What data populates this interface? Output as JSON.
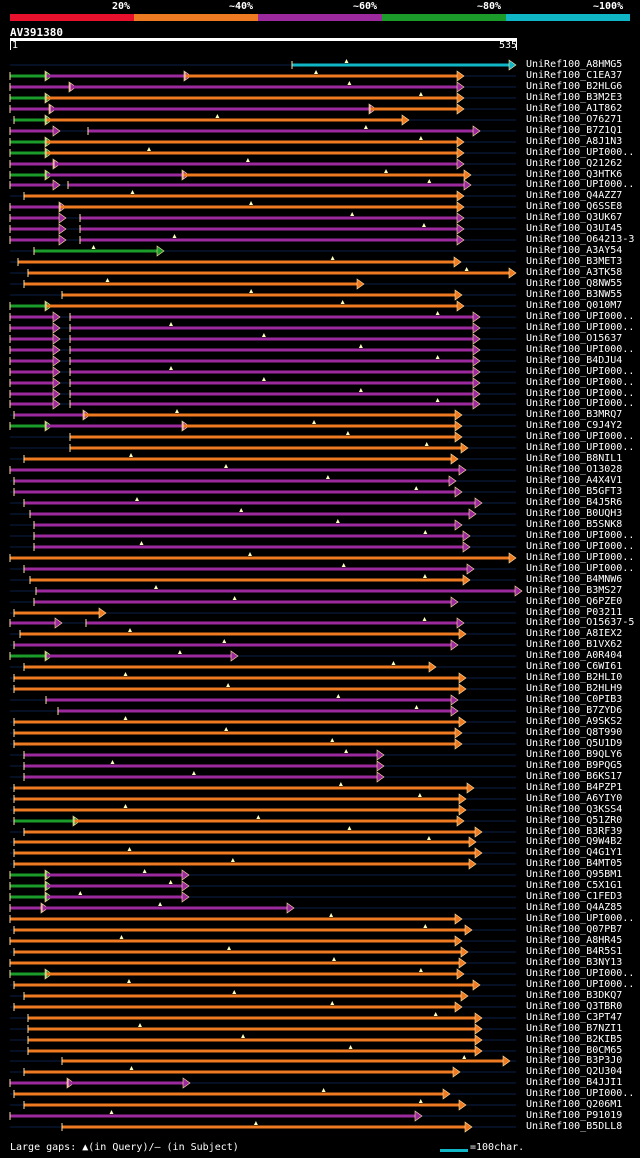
{
  "legend": {
    "labels": [
      "20%",
      "~40%",
      "~60%",
      "~80%",
      "~100%"
    ],
    "colors": [
      "#e8112d",
      "#ee7a21",
      "#9c2a9e",
      "#1a9b2a",
      "#10b5c6"
    ]
  },
  "query": {
    "id": "AV391380",
    "start": "1",
    "end": "535"
  },
  "hits": [
    {
      "name": "UniRef100_A8HMG5"
    },
    {
      "name": "UniRef100_C1EA37"
    },
    {
      "name": "UniRef100_B2HLG6"
    },
    {
      "name": "UniRef100_B3M2E3"
    },
    {
      "name": "UniRef100_A1T862"
    },
    {
      "name": "UniRef100_O76271"
    },
    {
      "name": "UniRef100_B7Z1Q1"
    },
    {
      "name": "UniRef100_A8J1N3"
    },
    {
      "name": "UniRef100_UPI000.."
    },
    {
      "name": "UniRef100_Q21262"
    },
    {
      "name": "UniRef100_Q3HTK6"
    },
    {
      "name": "UniRef100_UPI000.."
    },
    {
      "name": "UniRef100_Q4AZZ7"
    },
    {
      "name": "UniRef100_Q6SSE8"
    },
    {
      "name": "UniRef100_Q3UK67"
    },
    {
      "name": "UniRef100_Q3UI45"
    },
    {
      "name": "UniRef100_O64213-3"
    },
    {
      "name": "UniRef100_A3AY54"
    },
    {
      "name": "UniRef100_B3MET3"
    },
    {
      "name": "UniRef100_A3TK58"
    },
    {
      "name": "UniRef100_Q8NW55"
    },
    {
      "name": "UniRef100_B3NW55"
    },
    {
      "name": "UniRef100_Q010M7"
    },
    {
      "name": "UniRef100_UPI000.."
    },
    {
      "name": "UniRef100_UPI000.."
    },
    {
      "name": "UniRef100_O15637"
    },
    {
      "name": "UniRef100_UPI000.."
    },
    {
      "name": "UniRef100_B4DJU4"
    },
    {
      "name": "UniRef100_UPI000.."
    },
    {
      "name": "UniRef100_UPI000.."
    },
    {
      "name": "UniRef100_UPI000.."
    },
    {
      "name": "UniRef100_UPI000.."
    },
    {
      "name": "UniRef100_B3MRQ7"
    },
    {
      "name": "UniRef100_C9J4Y2"
    },
    {
      "name": "UniRef100_UPI000.."
    },
    {
      "name": "UniRef100_UPI000.."
    },
    {
      "name": "UniRef100_B8NIL1"
    },
    {
      "name": "UniRef100_O13028"
    },
    {
      "name": "UniRef100_A4X4V1"
    },
    {
      "name": "UniRef100_B5GFT3"
    },
    {
      "name": "UniRef100_B4J5R6"
    },
    {
      "name": "UniRef100_B0UQH3"
    },
    {
      "name": "UniRef100_B5SNK8"
    },
    {
      "name": "UniRef100_UPI000.."
    },
    {
      "name": "UniRef100_UPI000.."
    },
    {
      "name": "UniRef100_UPI000.."
    },
    {
      "name": "UniRef100_UPI000.."
    },
    {
      "name": "UniRef100_B4MNW6"
    },
    {
      "name": "UniRef100_B3MS27"
    },
    {
      "name": "UniRef100_Q6PZE0"
    },
    {
      "name": "UniRef100_P03211"
    },
    {
      "name": "UniRef100_O15637-5"
    },
    {
      "name": "UniRef100_A8IEX2"
    },
    {
      "name": "UniRef100_B1VX62"
    },
    {
      "name": "UniRef100_A0R404"
    },
    {
      "name": "UniRef100_C6WI61"
    },
    {
      "name": "UniRef100_B2HLI0"
    },
    {
      "name": "UniRef100_B2HLH9"
    },
    {
      "name": "UniRef100_C0PIB3"
    },
    {
      "name": "UniRef100_B7ZYD6"
    },
    {
      "name": "UniRef100_A9SKS2"
    },
    {
      "name": "UniRef100_Q8T990"
    },
    {
      "name": "UniRef100_Q5U1D9"
    },
    {
      "name": "UniRef100_B9QLY6"
    },
    {
      "name": "UniRef100_B9PQG5"
    },
    {
      "name": "UniRef100_B6KS17"
    },
    {
      "name": "UniRef100_B4PZP1"
    },
    {
      "name": "UniRef100_A6YIY0"
    },
    {
      "name": "UniRef100_Q3KSS4"
    },
    {
      "name": "UniRef100_Q51ZR0"
    },
    {
      "name": "UniRef100_B3RF39"
    },
    {
      "name": "UniRef100_Q9W4B2"
    },
    {
      "name": "UniRef100_Q4G1Y1"
    },
    {
      "name": "UniRef100_B4MT05"
    },
    {
      "name": "UniRef100_Q95BM1"
    },
    {
      "name": "UniRef100_C5X1G1"
    },
    {
      "name": "UniRef100_C1FED3"
    },
    {
      "name": "UniRef100_Q4AZ85"
    },
    {
      "name": "UniRef100_UPI000.."
    },
    {
      "name": "UniRef100_Q07PB7"
    },
    {
      "name": "UniRef100_A8HR45"
    },
    {
      "name": "UniRef100_B4R5S1"
    },
    {
      "name": "UniRef100_B3NY13"
    },
    {
      "name": "UniRef100_UPI000.."
    },
    {
      "name": "UniRef100_UPI000.."
    },
    {
      "name": "UniRef100_B3DKQ7"
    },
    {
      "name": "UniRef100_Q3TBR0"
    },
    {
      "name": "UniRef100_C3PT47"
    },
    {
      "name": "UniRef100_B7NZI1"
    },
    {
      "name": "UniRef100_B2KIB5"
    },
    {
      "name": "UniRef100_B0CM65"
    },
    {
      "name": "UniRef100_B3P3J0"
    },
    {
      "name": "UniRef100_Q2U304"
    },
    {
      "name": "UniRef100_B4JJI1"
    },
    {
      "name": "UniRef100_UPI000.."
    },
    {
      "name": "UniRef100_Q206M1"
    },
    {
      "name": "UniRef100_P91019"
    },
    {
      "name": "UniRef100_B5DLL8"
    }
  ],
  "footer": {
    "gaps_text": "Large gaps: ▲(in Query)/– (in Subject)",
    "scale_text": "=100char."
  }
}
